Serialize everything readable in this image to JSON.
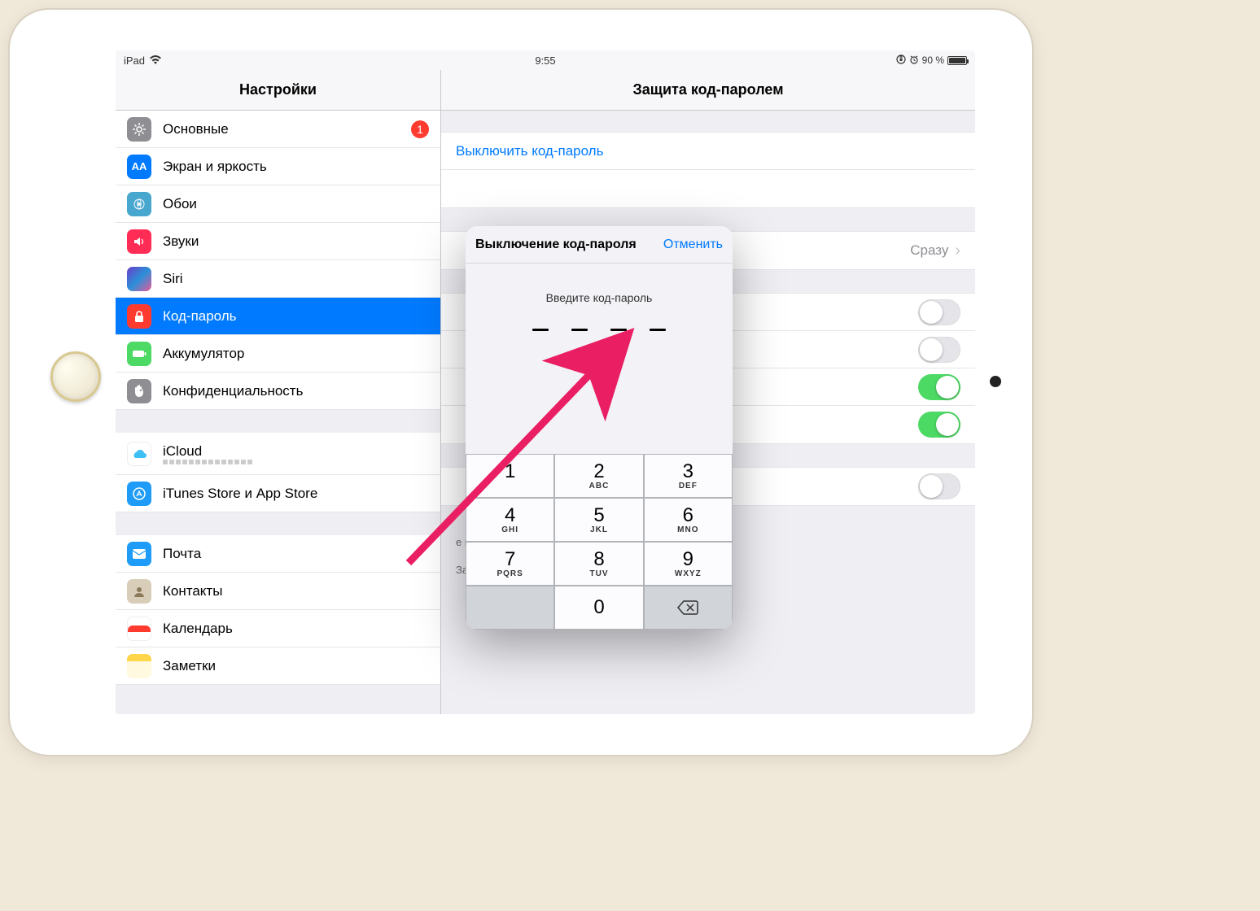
{
  "status": {
    "device": "iPad",
    "time": "9:55",
    "battery_pct": "90 %"
  },
  "headers": {
    "left": "Настройки",
    "right": "Защита код-паролем"
  },
  "sidebar": {
    "group1": [
      {
        "label": "Основные",
        "badge": "1"
      },
      {
        "label": "Экран и яркость"
      },
      {
        "label": "Обои"
      },
      {
        "label": "Звуки"
      },
      {
        "label": "Siri"
      },
      {
        "label": "Код-пароль",
        "selected": true
      },
      {
        "label": "Аккумулятор"
      },
      {
        "label": "Конфиденциальность"
      }
    ],
    "group2": [
      {
        "label": "iCloud"
      },
      {
        "label": "iTunes Store и App Store"
      }
    ],
    "group3": [
      {
        "label": "Почта"
      },
      {
        "label": "Контакты"
      },
      {
        "label": "Календарь"
      },
      {
        "label": "Заметки"
      }
    ]
  },
  "rpane": {
    "turn_off": "Выключить код-пароль",
    "require_value": "Сразу",
    "footer1": "е нескольких неудачных попыток ввода код-пароля (10).",
    "footer2": "Защита данных включена."
  },
  "modal": {
    "title": "Выключение код-пароля",
    "cancel": "Отменить",
    "prompt": "Введите код-пароль",
    "keys": [
      {
        "n": "1",
        "l": ""
      },
      {
        "n": "2",
        "l": "ABC"
      },
      {
        "n": "3",
        "l": "DEF"
      },
      {
        "n": "4",
        "l": "GHI"
      },
      {
        "n": "5",
        "l": "JKL"
      },
      {
        "n": "6",
        "l": "MNO"
      },
      {
        "n": "7",
        "l": "PQRS"
      },
      {
        "n": "8",
        "l": "TUV"
      },
      {
        "n": "9",
        "l": "WXYZ"
      },
      {
        "n": "",
        "l": ""
      },
      {
        "n": "0",
        "l": ""
      },
      {
        "n": "⌫",
        "l": ""
      }
    ]
  }
}
